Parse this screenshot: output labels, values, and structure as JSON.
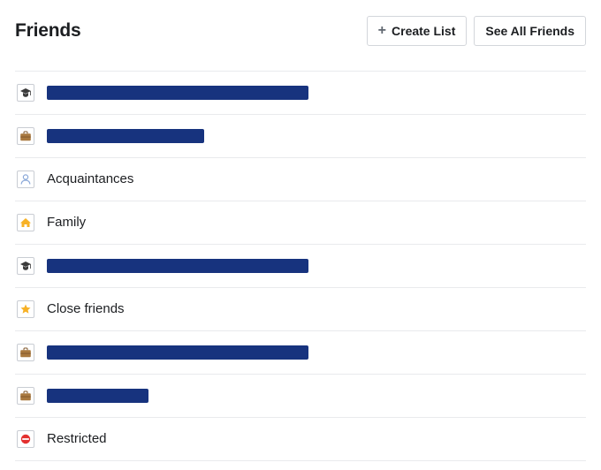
{
  "header": {
    "title": "Friends",
    "create_list_label": "Create List",
    "see_all_label": "See All Friends"
  },
  "redaction": {
    "color": "#17337e"
  },
  "lists": [
    {
      "icon": "grad",
      "label": null,
      "redacted": true,
      "redact_width": 296
    },
    {
      "icon": "work",
      "label": null,
      "redacted": true,
      "redact_width": 178
    },
    {
      "icon": "person",
      "label": "Acquaintances",
      "redacted": false
    },
    {
      "icon": "home",
      "label": "Family",
      "redacted": false
    },
    {
      "icon": "grad",
      "label": null,
      "redacted": true,
      "redact_width": 296
    },
    {
      "icon": "star",
      "label": "Close friends",
      "redacted": false
    },
    {
      "icon": "work",
      "label": null,
      "redacted": true,
      "redact_width": 296
    },
    {
      "icon": "work",
      "label": null,
      "redacted": true,
      "redact_width": 115
    },
    {
      "icon": "no",
      "label": "Restricted",
      "redacted": false
    }
  ]
}
